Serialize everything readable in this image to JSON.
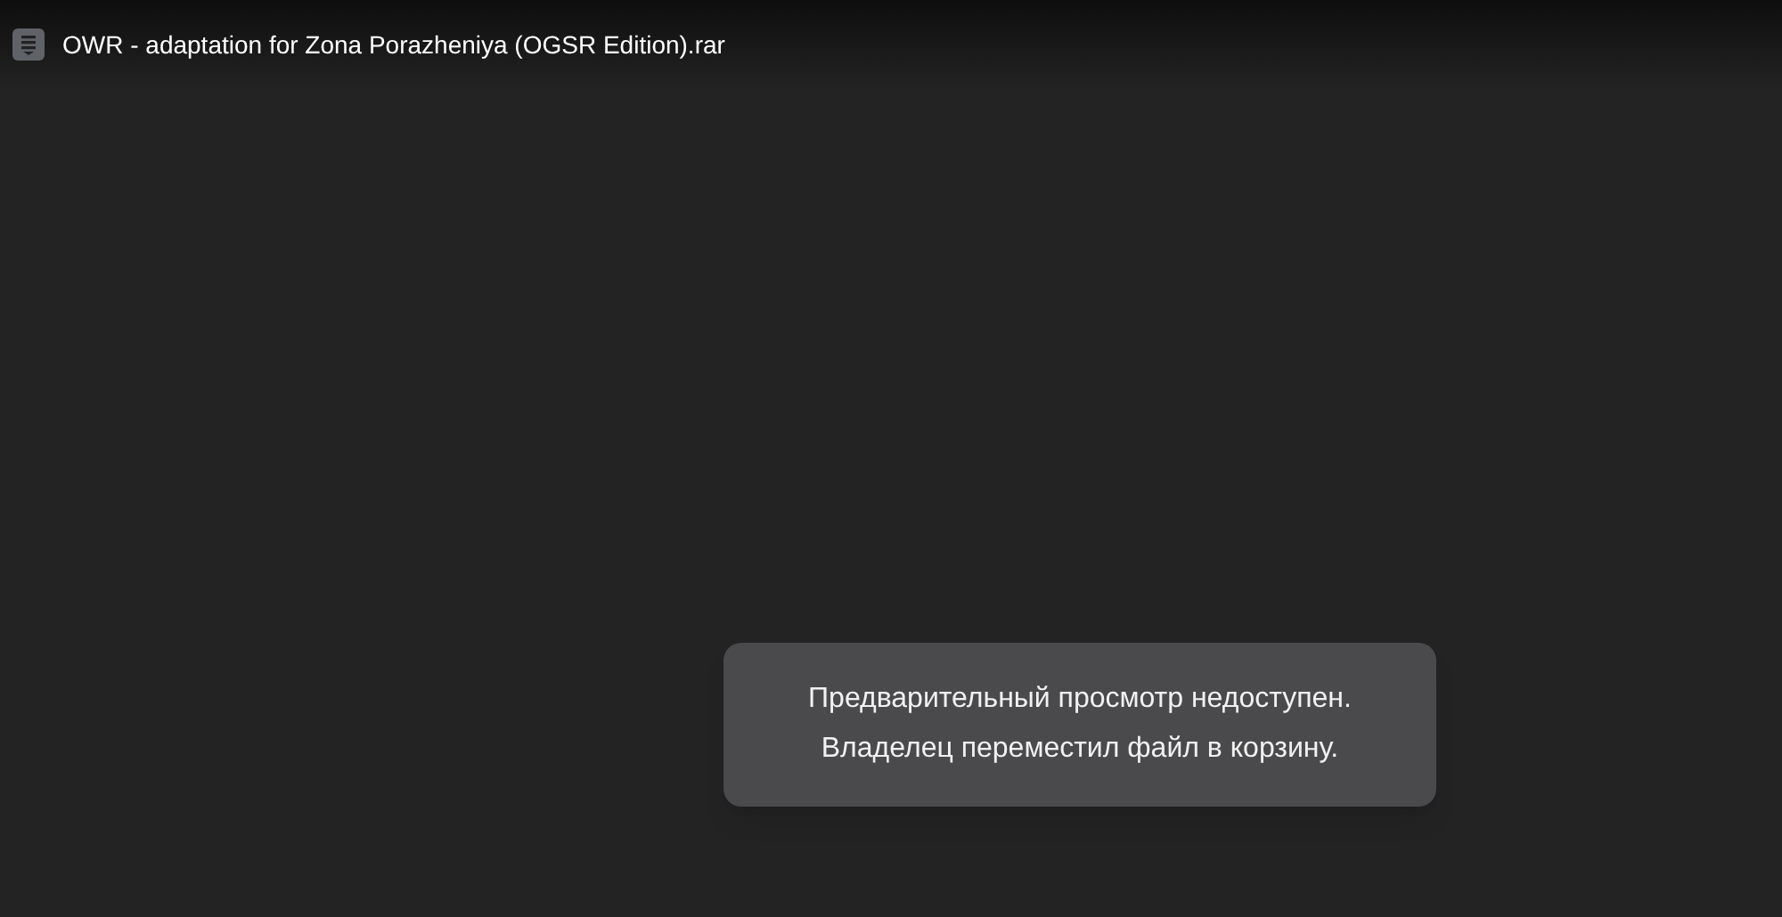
{
  "header": {
    "file_name": "OWR - adaptation for Zona Porazheniya (OGSR Edition).rar"
  },
  "message": {
    "lines": [
      "Предварительный просмотр недоступен.",
      "Владелец переместил файл в корзину."
    ]
  }
}
